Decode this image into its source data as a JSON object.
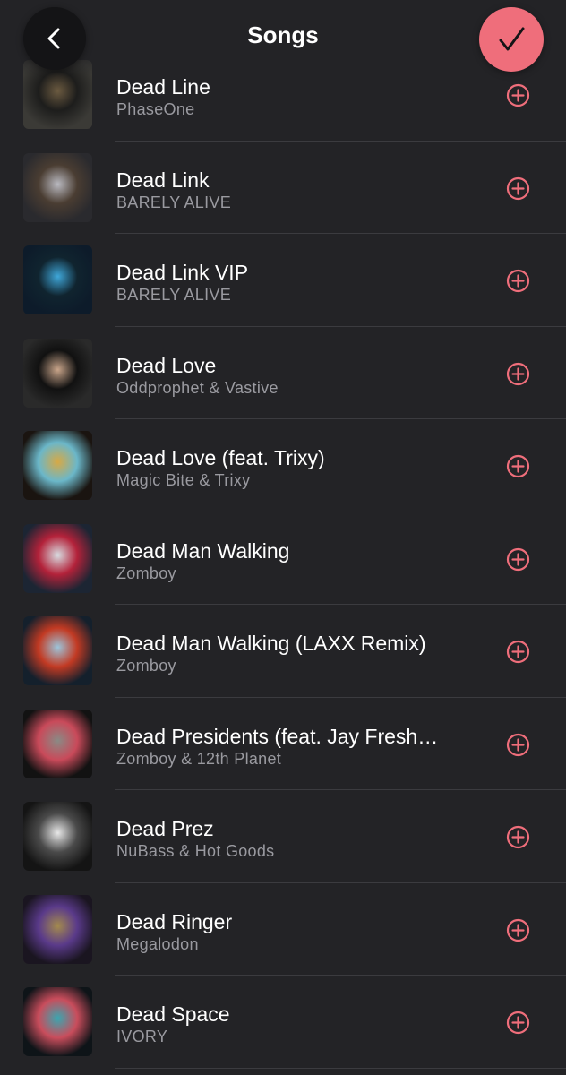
{
  "header": {
    "title": "Songs",
    "accent_color": "#ef6e7b",
    "back_icon": "chevron-left-icon",
    "done_icon": "checkmark-icon"
  },
  "songs": [
    {
      "title": "Dead Line",
      "artist": "PhaseOne",
      "art_colors": [
        "#3b3a36",
        "#6b5a40",
        "#1d1d1c"
      ]
    },
    {
      "title": "Dead Link",
      "artist": "BARELY ALIVE",
      "art_colors": [
        "#2a2a2e",
        "#b9b9c0",
        "#4a3d32"
      ]
    },
    {
      "title": "Dead Link VIP",
      "artist": "BARELY ALIVE",
      "art_colors": [
        "#0d1b2a",
        "#3fa7d9",
        "#10242f"
      ]
    },
    {
      "title": "Dead Love",
      "artist": "Oddprophet & Vastive",
      "art_colors": [
        "#2a2a2a",
        "#c9a58a",
        "#111111"
      ]
    },
    {
      "title": "Dead Love (feat. Trixy)",
      "artist": "Magic Bite & Trixy",
      "art_colors": [
        "#1a1410",
        "#d7a945",
        "#6bb7c9"
      ]
    },
    {
      "title": "Dead Man Walking",
      "artist": "Zomboy",
      "art_colors": [
        "#1c2533",
        "#d7dbe0",
        "#b3223a"
      ]
    },
    {
      "title": "Dead Man Walking (LAXX Remix)",
      "artist": "Zomboy",
      "art_colors": [
        "#14202c",
        "#9cc5db",
        "#c23a23"
      ]
    },
    {
      "title": "Dead Presidents (feat. Jay Fresh…",
      "artist": "Zomboy & 12th Planet",
      "art_colors": [
        "#121212",
        "#8a8a85",
        "#c94a5a"
      ]
    },
    {
      "title": "Dead Prez",
      "artist": "NuBass & Hot Goods",
      "art_colors": [
        "#141414",
        "#e8e8e8",
        "#4a4a4a"
      ]
    },
    {
      "title": "Dead Ringer",
      "artist": "Megalodon",
      "art_colors": [
        "#1a1520",
        "#a38a4d",
        "#5a3a8a"
      ]
    },
    {
      "title": "Dead Space",
      "artist": "IVORY",
      "art_colors": [
        "#0e1418",
        "#3aa6b0",
        "#c94d5c"
      ]
    }
  ],
  "add_icon": "plus-circle-icon"
}
